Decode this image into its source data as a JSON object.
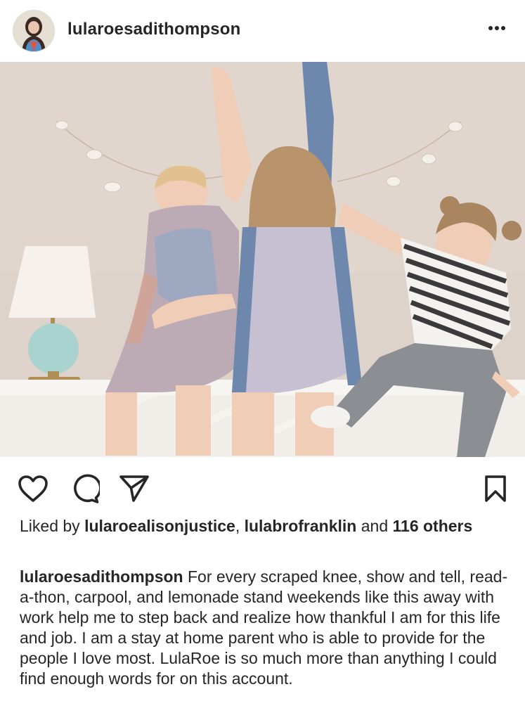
{
  "post": {
    "username": "lularoesadithompson",
    "likes": {
      "prefix": "Liked by ",
      "user1": "lularoealisonjustice",
      "sep": ", ",
      "user2": "lulabrofranklin",
      "and": " and ",
      "count": "116 others"
    },
    "caption": {
      "username": "lularoesadithompson",
      "text": " For every scraped knee, show and tell, read-a-thon, carpool, and lemonade stand weekends like this away with work help me to step back and realize how thankful I am for this life and job. I am a stay at home parent who is able to provide for the people I love most. LulaRoe is so much more than anything I could find enough words for on this account."
    },
    "actions": {
      "like": "heart-icon",
      "comment": "comment-bubble-icon",
      "share": "paper-plane-icon",
      "save": "bookmark-icon",
      "more": "more-options-icon"
    }
  },
  "colors": {
    "text": "#262626",
    "wall": "#ddd3ca",
    "bench": "#f1eeea"
  }
}
